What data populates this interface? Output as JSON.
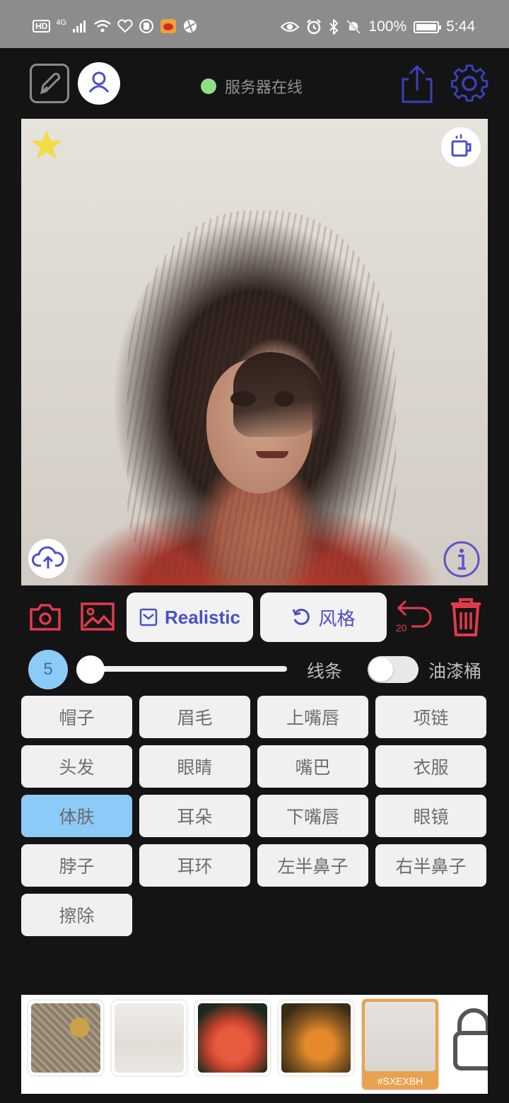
{
  "status_bar": {
    "network_label": "HD",
    "signal_label": "4G",
    "battery_percent": "100%",
    "time": "5:44"
  },
  "toolbar": {
    "server_status": "服务器在线",
    "server_status_color": "#8fe085",
    "accent_color": "#4b50c2"
  },
  "canvas": {
    "icons": [
      "star-icon",
      "coffee-cup-icon",
      "cloud-upload-icon",
      "info-icon"
    ]
  },
  "tools": {
    "realistic_label": "Realistic",
    "style_label": "风格",
    "undo_count": "20"
  },
  "brush": {
    "size": "5",
    "slider_fraction": 0.0,
    "lines_label": "线条",
    "bucket_label": "油漆桶",
    "bucket_enabled": false
  },
  "parts": [
    {
      "label": "帽子",
      "selected": false
    },
    {
      "label": "眉毛",
      "selected": false
    },
    {
      "label": "上嘴唇",
      "selected": false
    },
    {
      "label": "项链",
      "selected": false
    },
    {
      "label": "头发",
      "selected": false
    },
    {
      "label": "眼睛",
      "selected": false
    },
    {
      "label": "嘴巴",
      "selected": false
    },
    {
      "label": "衣服",
      "selected": false
    },
    {
      "label": "体肤",
      "selected": true
    },
    {
      "label": "耳朵",
      "selected": false
    },
    {
      "label": "下嘴唇",
      "selected": false
    },
    {
      "label": "眼镜",
      "selected": false
    },
    {
      "label": "脖子",
      "selected": false
    },
    {
      "label": "耳环",
      "selected": false
    },
    {
      "label": "左半鼻子",
      "selected": false
    },
    {
      "label": "右半鼻子",
      "selected": false
    },
    {
      "label": "擦除",
      "selected": false
    }
  ],
  "textures": {
    "selected_code": "#SXEXBH"
  }
}
